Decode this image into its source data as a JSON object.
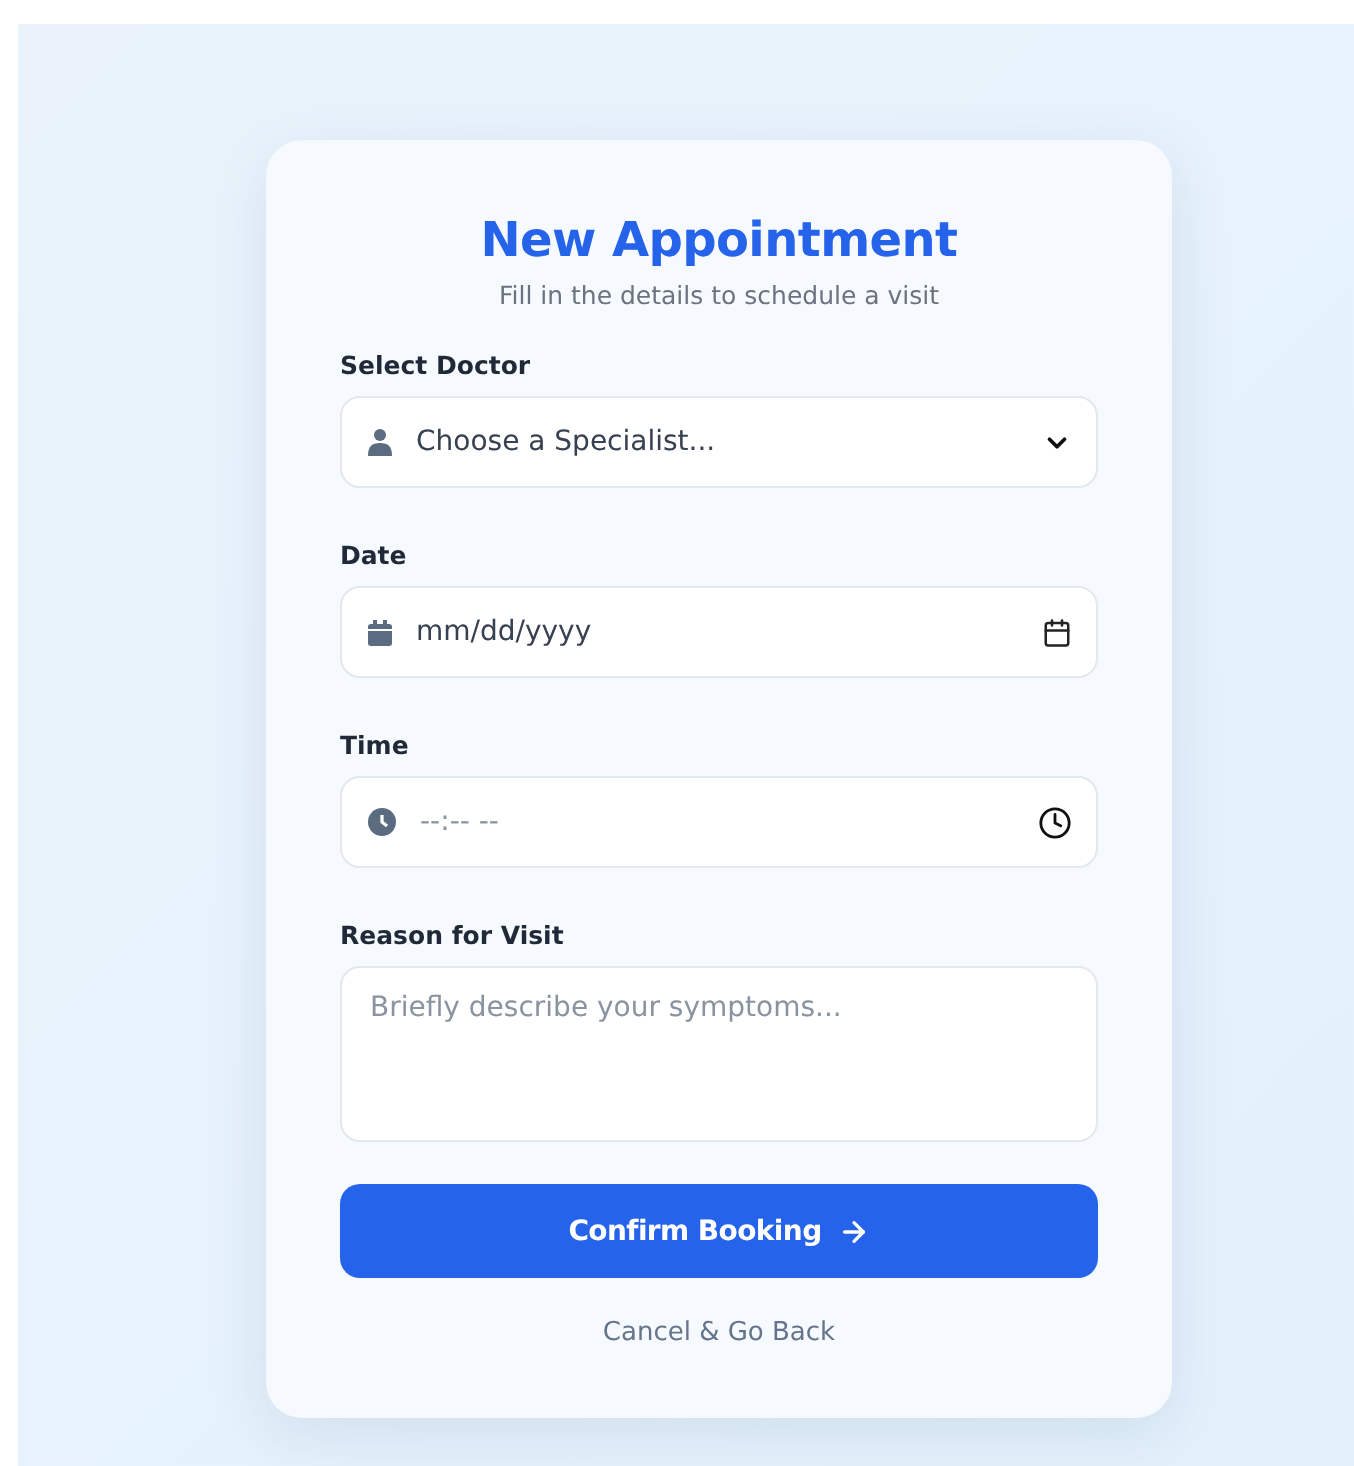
{
  "title": "New Appointment",
  "subtitle": "Fill in the details to schedule a visit",
  "fields": [
    {
      "kind": "select",
      "label": "Select Doctor",
      "value": "Choose a Specialist..."
    },
    {
      "kind": "date",
      "label": "Date",
      "value": "mm/dd/yyyy"
    },
    {
      "kind": "time",
      "label": "Time",
      "placeholder": "--:-- --"
    },
    {
      "kind": "textarea",
      "label": "Reason for Visit",
      "placeholder": "Briefly describe your symptoms..."
    }
  ],
  "submit": "Confirm Booking",
  "cancel": "Cancel & Go Back"
}
